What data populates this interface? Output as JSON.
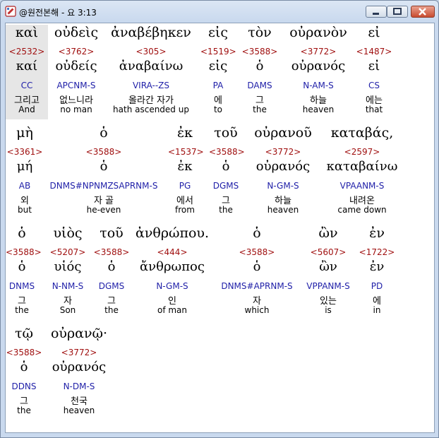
{
  "window": {
    "title": "@원전본해 - 요 3:13",
    "icon": "bible-app-icon"
  },
  "words": [
    {
      "greek": "καὶ",
      "strong": "<2532>",
      "lemma": "καί",
      "parse": "CC",
      "korean": "그리고",
      "english": "And",
      "selected": true
    },
    {
      "greek": "οὐδεὶς",
      "strong": "<3762>",
      "lemma": "οὐδείς",
      "parse": "APCNM-S",
      "korean": "없느니라",
      "english": "no man"
    },
    {
      "greek": "ἀναβέβηκεν",
      "strong": "<305>",
      "lemma": "ἀναβαίνω",
      "parse": "VIRA--ZS",
      "korean": "올라간 자가",
      "english": "hath ascended up"
    },
    {
      "greek": "εἰς",
      "strong": "<1519>",
      "lemma": "εἰς",
      "parse": "PA",
      "korean": "에",
      "english": "to"
    },
    {
      "greek": "τὸν",
      "strong": "<3588>",
      "lemma": "ὁ",
      "parse": "DAMS",
      "korean": "그",
      "english": "the"
    },
    {
      "greek": "οὐρανὸν",
      "strong": "<3772>",
      "lemma": "οὐρανός",
      "parse": "N-AM-S",
      "korean": "하늘",
      "english": "heaven"
    },
    {
      "greek": "εἰ",
      "strong": "<1487>",
      "lemma": "εἰ",
      "parse": "CS",
      "korean": "에는",
      "english": "that"
    },
    {
      "greek": "μὴ",
      "strong": "<3361>",
      "lemma": "μή",
      "parse": "AB",
      "korean": "외",
      "english": "but"
    },
    {
      "greek": "ὁ",
      "strong": "<3588>",
      "lemma": "ὁ",
      "parse": "DNMS#NPNMZSAPRNM-S",
      "korean": "자 골",
      "english": "he-even"
    },
    {
      "greek": "ἐκ",
      "strong": "<1537>",
      "lemma": "ἐκ",
      "parse": "PG",
      "korean": "에서",
      "english": "from"
    },
    {
      "greek": "τοῦ",
      "strong": "<3588>",
      "lemma": "ὁ",
      "parse": "DGMS",
      "korean": "그",
      "english": "the"
    },
    {
      "greek": "οὐρανοῦ",
      "strong": "<3772>",
      "lemma": "οὐρανός",
      "parse": "N-GM-S",
      "korean": "하늘",
      "english": "heaven"
    },
    {
      "greek": "καταβάς,",
      "strong": "<2597>",
      "lemma": "καταβαίνω",
      "parse": "VPAANM-S",
      "korean": "내려온",
      "english": "came down"
    },
    {
      "greek": "ὁ",
      "strong": "<3588>",
      "lemma": "ὁ",
      "parse": "DNMS",
      "korean": "그",
      "english": "the"
    },
    {
      "greek": "υἱὸς",
      "strong": "<5207>",
      "lemma": "υἱός",
      "parse": "N-NM-S",
      "korean": "자",
      "english": "Son"
    },
    {
      "greek": "τοῦ",
      "strong": "<3588>",
      "lemma": "ὁ",
      "parse": "DGMS",
      "korean": "그",
      "english": "the"
    },
    {
      "greek": "ἀνθρώπου.",
      "strong": "<444>",
      "lemma": "ἄνθρωπος",
      "parse": "N-GM-S",
      "korean": "인",
      "english": "of man"
    },
    {
      "greek": "ὁ",
      "strong": "<3588>",
      "lemma": "ὁ",
      "parse": "DNMS#APRNM-S",
      "korean": "자",
      "english": "which"
    },
    {
      "greek": "ὢν",
      "strong": "<5607>",
      "lemma": "ὢν",
      "parse": "VPPANM-S",
      "korean": "있는",
      "english": "is"
    },
    {
      "greek": "ἐν",
      "strong": "<1722>",
      "lemma": "ἐν",
      "parse": "PD",
      "korean": "에",
      "english": "in"
    },
    {
      "greek": "τῷ",
      "strong": "<3588>",
      "lemma": "ὁ",
      "parse": "DDNS",
      "korean": "그",
      "english": "the"
    },
    {
      "greek": "οὐρανῷ·",
      "strong": "<3772>",
      "lemma": "οὐρανός",
      "parse": "N-DM-S",
      "korean": "천국",
      "english": "heaven"
    }
  ]
}
